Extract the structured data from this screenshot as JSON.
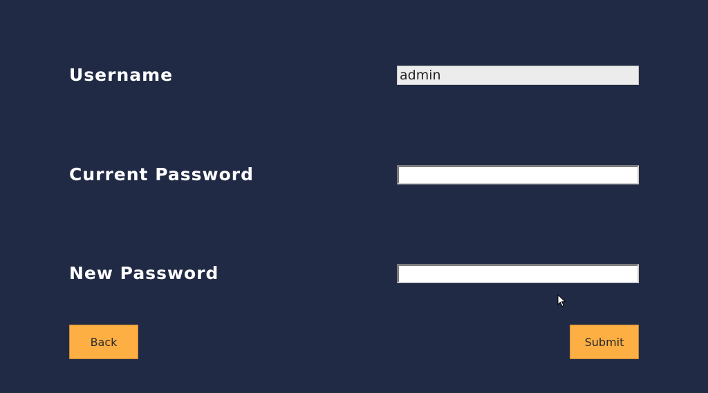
{
  "form": {
    "username": {
      "label": "Username",
      "value": "admin"
    },
    "current_password": {
      "label": "Current Password",
      "value": ""
    },
    "new_password": {
      "label": "New Password",
      "value": ""
    }
  },
  "actions": {
    "back_label": "Back",
    "submit_label": "Submit"
  },
  "colors": {
    "background": "#212a45",
    "button": "#fdaf44",
    "label_text": "#ffffff"
  },
  "icons": {
    "pointer": "mouse-pointer-icon"
  }
}
